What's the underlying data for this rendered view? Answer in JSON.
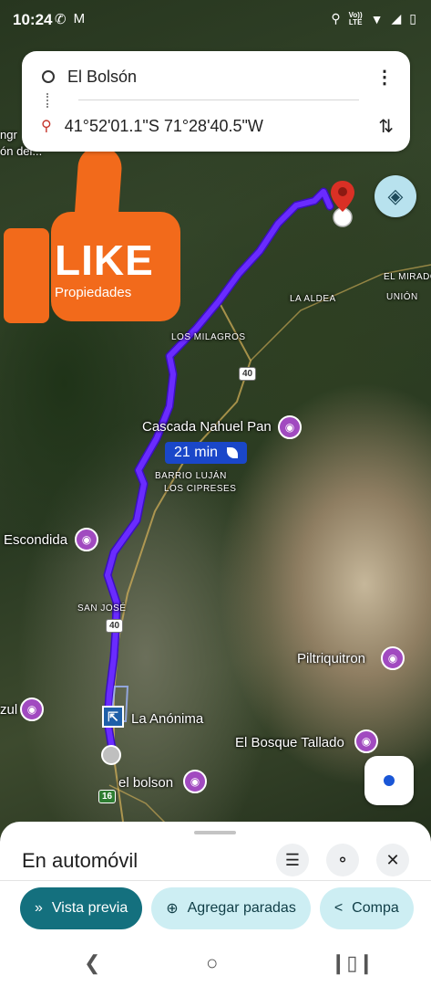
{
  "status_bar": {
    "time": "10:24",
    "left_icons": [
      "whatsapp-icon",
      "gmail-icon"
    ],
    "network_label_top": "Vo))",
    "network_label_bottom": "LTE",
    "right_icons": [
      "location-icon",
      "wifi-icon",
      "signal-icon",
      "battery-icon"
    ]
  },
  "directions": {
    "origin": "El Bolsón",
    "destination": "41°52'01.1\"S 71°28'40.5\"W"
  },
  "watermark": {
    "title": "LIKE",
    "subtitle": "Propiedades"
  },
  "map": {
    "labels": {
      "el_mirador": "EL MIRADO",
      "union": "UNIÓN",
      "la_aldea": "LA ALDEA",
      "los_milagros": "LOS MILAGROS",
      "cascada": "Cascada Nahuel Pan",
      "barrio_lujan": "BARRIO LUJÁN",
      "los_cipreses": "LOS CIPRESES",
      "escondida": "Escondida",
      "san_jose": "SAN JOSÉ",
      "piltriquitron": "Piltriquitron",
      "la_anonima": "La Anónima",
      "el_bosque": "El Bosque Tallado",
      "el_bolson": "el bolson",
      "zul": "zul",
      "ngr": "ngr",
      "on_del": "ón del..."
    },
    "route_shields": [
      "40",
      "40",
      "16"
    ],
    "eta": "21 min"
  },
  "sheet": {
    "title": "En automóvil",
    "chips": {
      "preview": "Vista previa",
      "add_stops": "Agregar paradas",
      "share": "Compa"
    }
  },
  "colors": {
    "route": "#5a1bff",
    "accent": "#14707e",
    "chip_secondary": "#cdeef3",
    "watermark": "#f26a1b",
    "dest_pin": "#d93025"
  }
}
